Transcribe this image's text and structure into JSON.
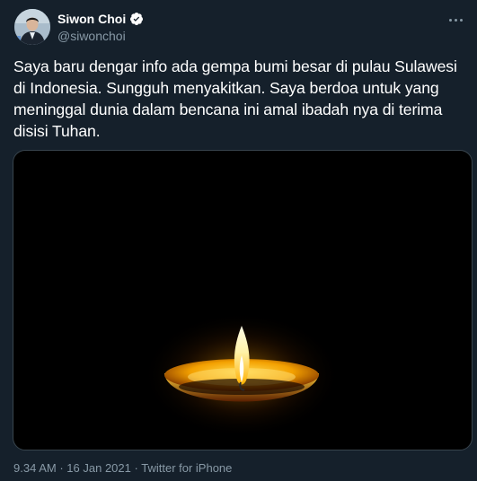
{
  "author": {
    "display_name": "Siwon Choi",
    "handle": "@siwonchoi"
  },
  "tweet": {
    "text": "Saya baru dengar info ada gempa bumi besar di pulau Sulawesi di Indonesia. Sungguh menyakitkan. Saya berdoa untuk yang meninggal dunia dalam bencana ini amal ibadah nya di terima disisi Tuhan.",
    "time": "9.34 AM",
    "separator": "·",
    "date": "16 Jan 2021",
    "source": "Twitter for iPhone"
  },
  "icons": {
    "verified": "verified-badge-icon",
    "more": "more-options-icon",
    "media": "candle-image"
  },
  "colors": {
    "background": "#15202b",
    "secondary_text": "#8899a6",
    "border": "#38444d"
  }
}
